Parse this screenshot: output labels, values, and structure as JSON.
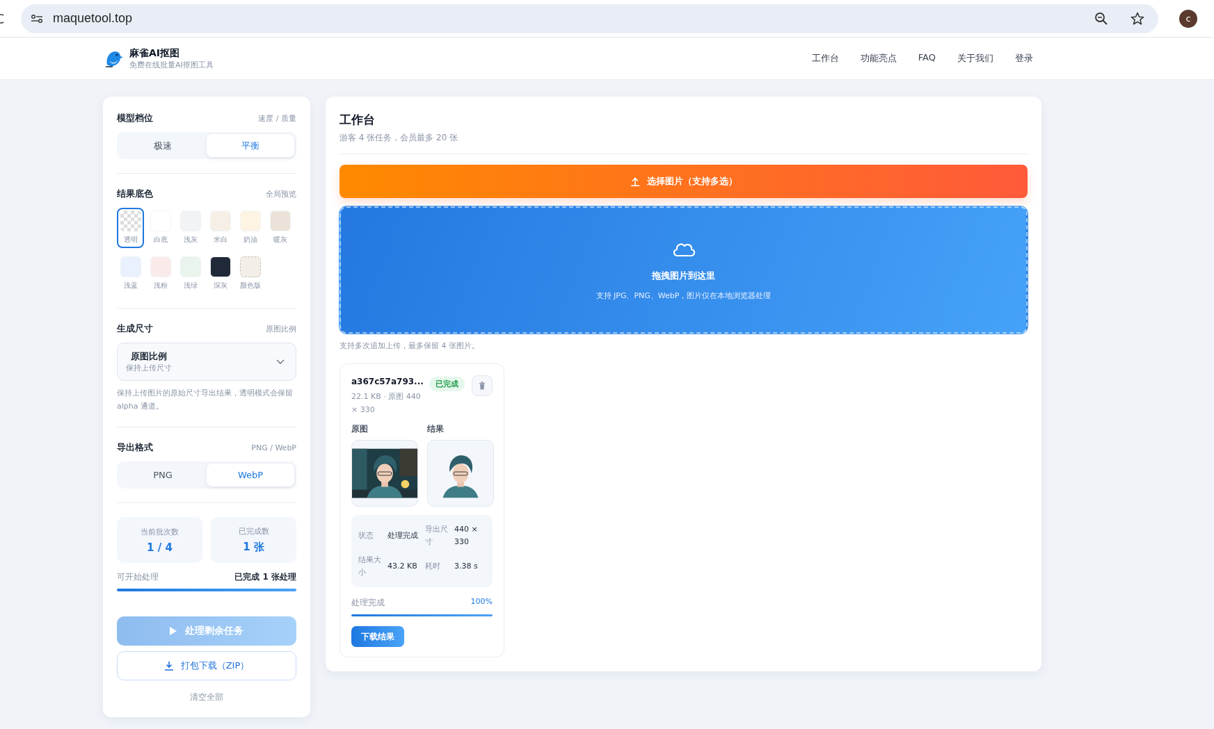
{
  "browser": {
    "url": "maquetool.top",
    "avatar": "c"
  },
  "header": {
    "brand": "麻雀AI抠图",
    "tagline": "免费在线批量AI抠图工具",
    "nav": [
      {
        "label": "工作台"
      },
      {
        "label": "功能亮点"
      },
      {
        "label": "FAQ"
      },
      {
        "label": "关于我们"
      },
      {
        "label": "登录"
      }
    ]
  },
  "sidebar": {
    "model": {
      "title": "模型档位",
      "hint": "速度 / 质量",
      "options": [
        {
          "label": "极速",
          "selected": false
        },
        {
          "label": "平衡",
          "selected": true
        }
      ]
    },
    "background": {
      "title": "结果底色",
      "hint": "全局预览",
      "swatches": [
        {
          "label": "透明",
          "kind": "transparent",
          "selected": true
        },
        {
          "label": "白底",
          "kind": "solid",
          "color": "#ffffff",
          "selected": false
        },
        {
          "label": "浅灰",
          "kind": "solid",
          "color": "#f1f3f5",
          "selected": false
        },
        {
          "label": "米白",
          "kind": "solid",
          "color": "#f5efe6",
          "selected": false
        },
        {
          "label": "奶油",
          "kind": "solid",
          "color": "#fdf4e3",
          "selected": false
        },
        {
          "label": "暖灰",
          "kind": "solid",
          "color": "#ebe3d9",
          "selected": false
        },
        {
          "label": "浅蓝",
          "kind": "solid",
          "color": "#e8f1fd",
          "selected": false
        },
        {
          "label": "浅粉",
          "kind": "solid",
          "color": "#fbeaea",
          "selected": false
        },
        {
          "label": "浅绿",
          "kind": "solid",
          "color": "#e8f4ec",
          "selected": false
        },
        {
          "label": "深灰",
          "kind": "solid",
          "color": "#1f2937",
          "selected": false
        },
        {
          "label": "颜色版",
          "kind": "custom",
          "color": "#f3efe8",
          "selected": false
        }
      ]
    },
    "size": {
      "title": "生成尺寸",
      "hint": "原图比例",
      "select": {
        "value": "原图比例",
        "sub": "保持上传尺寸"
      },
      "note": "保持上传图片的原始尺寸导出结果，透明模式会保留 alpha 通道。"
    },
    "format": {
      "title": "导出格式",
      "hint": "PNG / WebP",
      "options": [
        {
          "label": "PNG",
          "selected": false
        },
        {
          "label": "WebP",
          "selected": true
        }
      ]
    },
    "stats": [
      {
        "label": "当前批次数",
        "value": "1 / 4"
      },
      {
        "label": "已完成数",
        "value": "1 张"
      }
    ],
    "progress": {
      "left": "可开始处理",
      "right": "已完成 1 张处理",
      "level": 1
    },
    "process_button": {
      "label": "处理剩余任务",
      "disabled": true
    },
    "zip_button": {
      "label": "打包下载（ZIP）"
    },
    "clear": {
      "label": "清空全部"
    }
  },
  "main": {
    "title": "工作台",
    "subtitle": "游客 4 张任务，会员最多 20 张",
    "select_button": "选择图片（支持多选）",
    "dropzone": {
      "title": "拖拽图片到这里",
      "sub": "支持 JPG、PNG、WebP，图片仅在本地浏览器处理"
    },
    "note": "支持多次追加上传，最多保留 4 张图片。",
    "files": [
      {
        "name": "a367c57a793...",
        "status": "已完成",
        "meta": "22.1 KB · 原图 440 × 330",
        "original_label": "原图",
        "result_label": "结果",
        "details": [
          {
            "label": "状态",
            "value": "处理完成"
          },
          {
            "label": "导出尺寸",
            "value": "440 × 330"
          },
          {
            "label": "结果大小",
            "value": "43.2 KB"
          },
          {
            "label": "耗时",
            "value": "3.38 s"
          }
        ],
        "progress": {
          "label": "处理完成",
          "percent": "100%",
          "level": 1
        },
        "download": "下载结果"
      }
    ]
  }
}
